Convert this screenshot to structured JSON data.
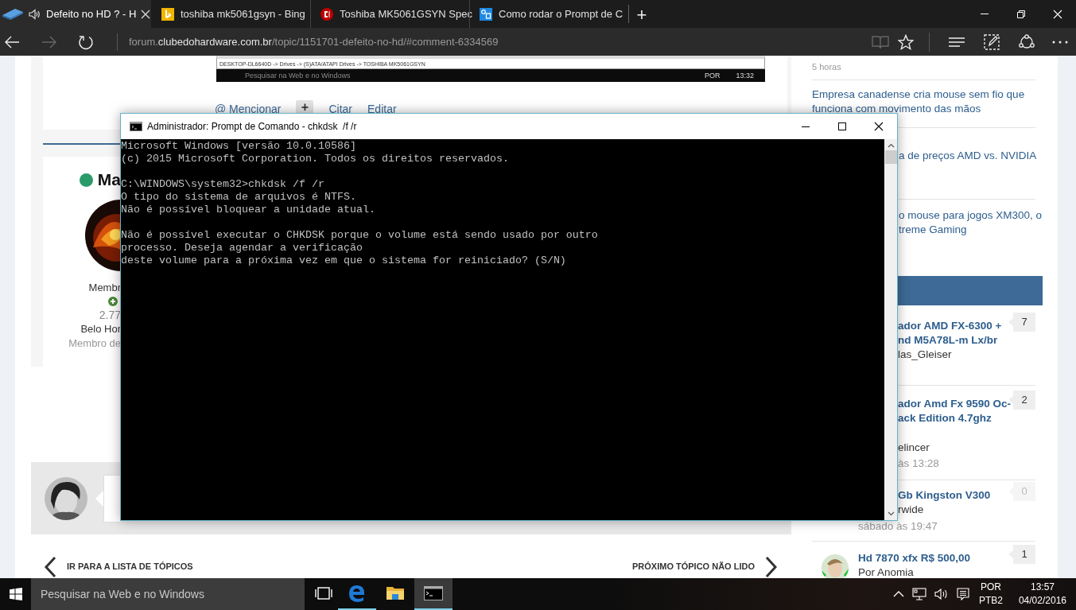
{
  "browser": {
    "tabs": [
      {
        "audio": true,
        "title": "Defeito no HD ? - H",
        "selected": true
      },
      {
        "audio": false,
        "title": "toshiba mk5061gsyn - Bing",
        "selected": false
      },
      {
        "audio": false,
        "title": "Toshiba MK5061GSYN Spec",
        "selected": false
      },
      {
        "audio": false,
        "title": "Como rodar o Prompt de C",
        "selected": false
      }
    ],
    "new_tab": "+",
    "url": {
      "prefix": "forum.",
      "domain": "clubedohardware.com.br",
      "path": "/topic/1151701-defeito-no-hd/#comment-6334569"
    },
    "forward_disabled": true,
    "reading_view_disabled": true
  },
  "post": {
    "image": {
      "path": "DESKTOP-DL6640D -> Drives -> (S)ATA/ATAPI Drives -> TOSHIBA MK5061GSYN",
      "search": "Pesquisar na Web e no Windows",
      "language": "POR",
      "time": "13:32"
    },
    "actions": [
      {
        "kind": "link",
        "label": "@ Mencionar"
      },
      {
        "kind": "button",
        "label": "+"
      },
      {
        "kind": "link",
        "label": "Citar"
      },
      {
        "kind": "link",
        "label": "Editar"
      }
    ]
  },
  "author": {
    "online": true,
    "name": "Ma",
    "rank": "Membr",
    "reputation": "2.77",
    "location": "Belo Hor",
    "since": "Membro de"
  },
  "navigation": {
    "back": "IR PARA A LISTA DE TÓPICOS",
    "next": "PRÓXIMO TÓPICO NÃO LIDO"
  },
  "sidebar": {
    "news": [
      {
        "kind": "time",
        "lines": [
          "5 horas"
        ]
      },
      {
        "kind": "full",
        "lines": [
          "Empresa canadense cria mouse sem fio que",
          "funciona com movimento das mãos"
        ]
      },
      {
        "kind": "partial",
        "lines": [
          "a de preços AMD vs. NVIDIA"
        ]
      },
      {
        "kind": "partial",
        "lines": [
          "o mouse para jogos XM300, o",
          "treme Gaming"
        ]
      }
    ],
    "topics": [
      {
        "kind": "partial",
        "avatar": false,
        "title": [
          "ador AMD FX-6300 +",
          "nd M5A78L-m Lx/br"
        ],
        "author": "las_Gleiser",
        "replies": "7",
        "dimmed": false
      },
      {
        "kind": "partial",
        "avatar": false,
        "title": [
          "ador Amd Fx 9590 Oc-",
          "ack Edition 4.7ghz"
        ],
        "author": "elincer",
        "time": "às 13:28",
        "replies": "2",
        "dimmed": false
      },
      {
        "kind": "partial",
        "avatar": false,
        "title": [
          "Gb Kingston V300"
        ],
        "author": "rwide",
        "time": "sábado às 19:47",
        "replies": "0",
        "dimmed": true
      },
      {
        "kind": "full",
        "avatar": true,
        "title": [
          "Hd 7870 xfx R$ 500,00"
        ],
        "author": "Por Anomia",
        "replies": "1",
        "dimmed": false
      }
    ]
  },
  "console": {
    "title": "Administrador: Prompt de Comando - chkdsk  /f /r",
    "blocks": [
      [
        "Microsoft Windows [versão 10.0.10586]",
        "(c) 2015 Microsoft Corporation. Todos os direitos reservados."
      ],
      [
        "C:\\WINDOWS\\system32>chkdsk /f /r",
        "O tipo do sistema de arquivos é NTFS.",
        "Não é possível bloquear a unidade atual."
      ],
      [
        "Não é possível executar o CHKDSK porque o volume está sendo usado por outro",
        "processo. Deseja agendar a verificação",
        "deste volume para a próxima vez em que o sistema for reiniciado? (S/N)"
      ]
    ]
  },
  "taskbar": {
    "search_placeholder": "Pesquisar na Web e no Windows",
    "apps": [
      {
        "kind": "task-view",
        "running": false,
        "selected": false
      },
      {
        "kind": "edge",
        "running": true,
        "selected": false
      },
      {
        "kind": "explorer",
        "running": false,
        "selected": false
      },
      {
        "kind": "console",
        "running": true,
        "selected": true
      }
    ],
    "language": [
      "POR",
      "PTB2"
    ],
    "time": "13:57",
    "date": "04/02/2016"
  }
}
